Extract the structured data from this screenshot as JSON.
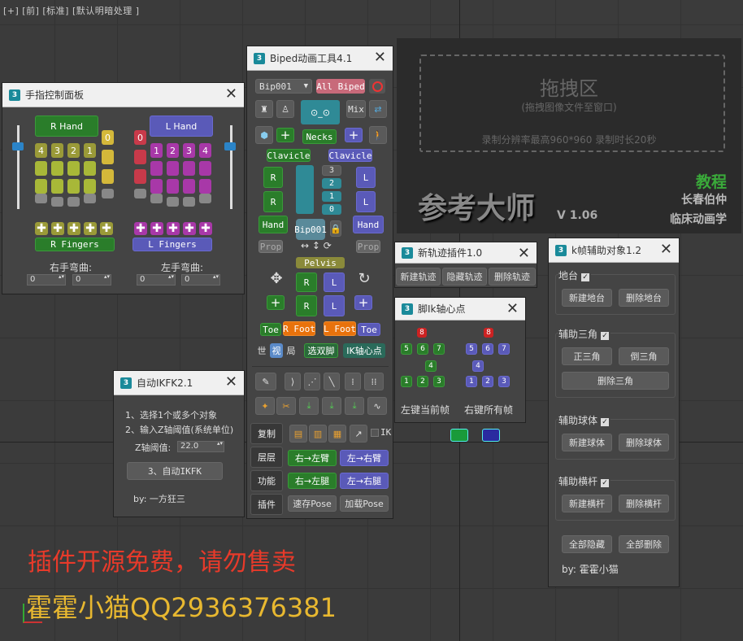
{
  "viewport": {
    "label": "[+] [前] [标准] [默认明暗处理 ]"
  },
  "finger": {
    "title": "手指控制面板",
    "r_hand": "R Hand",
    "l_hand": "L Hand",
    "r_nums": [
      "4",
      "3",
      "2",
      "1"
    ],
    "l_nums": [
      "1",
      "2",
      "3",
      "4"
    ],
    "r_thumb": "0",
    "l_thumb": "0",
    "r_fingers": "R Fingers",
    "l_fingers": "L Fingers",
    "right_bend": "右手弯曲:",
    "left_bend": "左手弯曲:",
    "spin": "0"
  },
  "biped": {
    "title": "Biped动画工具4.1",
    "select": "Bip001",
    "all": "All Biped",
    "mix": "Mix",
    "necks": "Necks",
    "clavicle": "Clavicle",
    "hand": "Hand",
    "prop": "Prop",
    "pelvis": "Pelvis",
    "bip": "Bip001",
    "spine": [
      "3",
      "2",
      "1",
      "0"
    ],
    "r": "R",
    "l": "L",
    "toe": "Toe",
    "rfoot": "R Foot",
    "lfoot": "L Foot",
    "world": "世",
    "view": "视",
    "local": "局",
    "select_feet": "选双脚",
    "ik_pivot": "IK轴心点",
    "ik": "IK",
    "tabs": [
      "复制",
      "层层",
      "功能",
      "插件"
    ],
    "r2l_arm": "右→左臂",
    "l2r_arm": "左→右臂",
    "r2l_leg": "右→左腿",
    "l2r_leg": "左→右腿",
    "save_pose": "速存Pose",
    "load_pose": "加载Pose"
  },
  "ikfk": {
    "title": "自动IKFK2.1",
    "line1": "1、选择1个或多个对象",
    "line2": "2、输入Z轴阈值(系统单位)",
    "z_label": "Z轴阈值:",
    "z_value": "22.0",
    "button": "3、自动IKFK",
    "by": "by: 一方狂三"
  },
  "drop": {
    "title": "拖拽区",
    "hint": "(拖拽图像文件至窗口)",
    "note": "录制分辨率最高960*960 录制时长20秒",
    "brand": "参考大师",
    "version": "V 1.06",
    "tutorial": "教程",
    "author": "长春伯仲",
    "studio": "临床动画学"
  },
  "track": {
    "title": "新轨迹插件1.0",
    "new": "新建轨迹",
    "hide": "隐藏轨迹",
    "del": "删除轨迹"
  },
  "pivot": {
    "title": "脚Ik轴心点",
    "top": "8",
    "row": [
      "5",
      "6",
      "7"
    ],
    "mid": "4",
    "bot": [
      "1",
      "2",
      "3"
    ],
    "left_btn": "左键当前帧",
    "right_btn": "右键所有帧"
  },
  "kframe": {
    "title": "k帧辅助对象1.2",
    "g1": "地台",
    "new_platform": "新建地台",
    "del_platform": "删除地台",
    "g2": "辅助三角",
    "tri_up": "正三角",
    "tri_down": "倒三角",
    "del_tri": "删除三角",
    "g3": "辅助球体",
    "new_sphere": "新建球体",
    "del_sphere": "删除球体",
    "g4": "辅助横杆",
    "new_bar": "新建横杆",
    "del_bar": "删除横杆",
    "hide_all": "全部隐藏",
    "del_all": "全部删除",
    "by": "by: 霍霍小猫"
  },
  "overlay": {
    "line1": "插件开源免费，请勿售卖",
    "line2": "霍霍小猫QQ2936376381"
  }
}
